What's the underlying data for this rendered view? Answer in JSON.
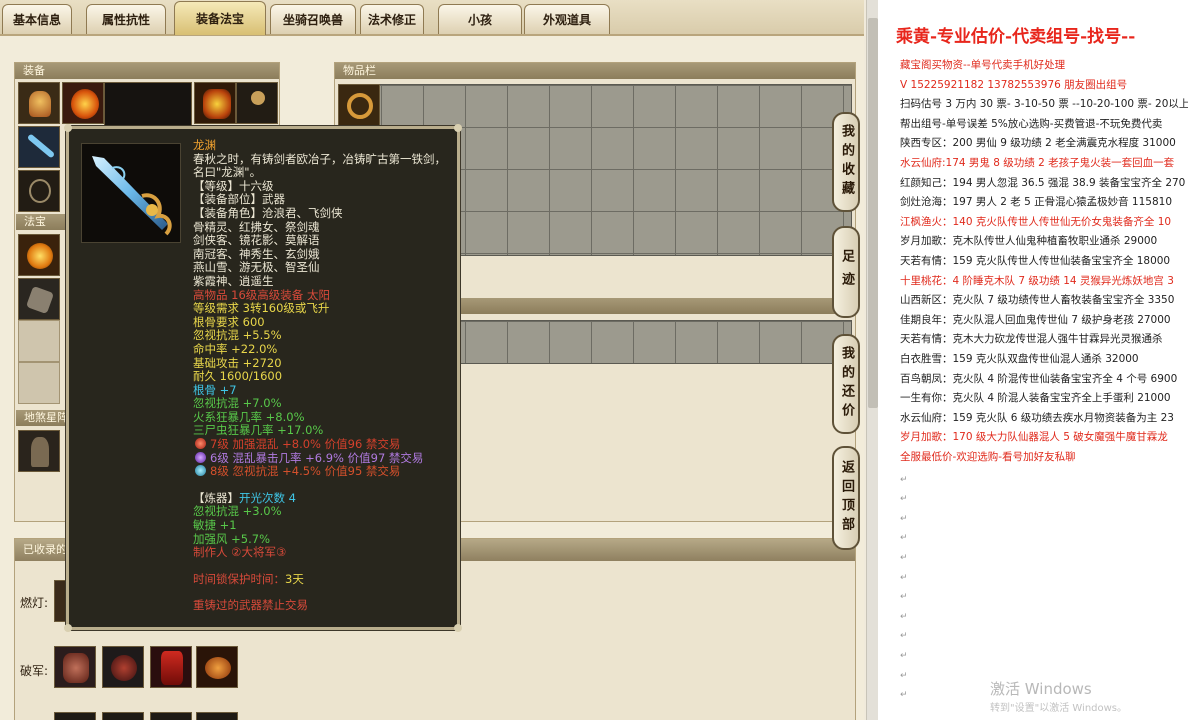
{
  "tabs": [
    "基本信息",
    "属性抗性",
    "装备法宝",
    "坐骑召唤兽",
    "法术修正",
    "小孩",
    "外观道具"
  ],
  "sections": {
    "equip": "装备",
    "inventory": "物品栏",
    "fabao": "法宝",
    "dishaxing": "地煞星阵",
    "collected": "已收录的"
  },
  "side_buttons": [
    "我的收藏",
    "足迹",
    "我的还价",
    "返回顶部"
  ],
  "collected_rows": [
    "燃灯:",
    "破军:"
  ],
  "tooltip": {
    "name": "龙渊",
    "desc1": "春秋之时，有铸剑者欧冶子，冶铸旷古第一铁剑，",
    "desc2": "名曰\"龙渊\"。",
    "level": "【等级】十六级",
    "slot": "【装备部位】武器",
    "roles_head": "【装备角色】沧浪君、飞剑侠",
    "roles": [
      "骨精灵、红拂女、祭剑魂",
      "剑侠客、镜花影、莫解语",
      "南冠客、神秀生、玄剑娥",
      "燕山雪、游无极、智圣仙",
      "紫霞神、逍遥生"
    ],
    "tradeable": "高物品 16级高级装备 太阳",
    "req1": "等级需求 3转160级或飞升",
    "req2": "根骨要求 600",
    "attrs": [
      "忽视抗混 +5.5%",
      "命中率 +22.0%",
      "基础攻击 +2720",
      "耐久 1600/1600"
    ],
    "gengu": "根骨 +7",
    "green_attrs": [
      "忽视抗混 +7.0%",
      "火系狂暴几率 +8.0%",
      "三尸虫狂暴几率 +17.0%"
    ],
    "gems": [
      {
        "text": "7级 加强混乱 +8.0% 价值96 禁交易",
        "color": "#d4402c"
      },
      {
        "text": "6级 混乱暴击几率 +6.9% 价值97 禁交易",
        "color": "#8e52d6"
      },
      {
        "text": "8级 忽视抗混 +4.5% 价值95 禁交易",
        "color": "#45a6c8"
      }
    ],
    "refine_label": "【炼器】",
    "refine_count": "开光次数 4",
    "refine_attrs": [
      "忽视抗混 +3.0%",
      "敏捷 +1",
      "加强风 +5.7%"
    ],
    "maker": "制作人 ②大将军③",
    "protect_label": "时间锁保护时间：",
    "protect_value": "3天",
    "forbid": "重铸过的武器禁止交易"
  },
  "doc": {
    "title": "乘黄-专业估价-代卖组号-找号--",
    "lines": [
      {
        "t": "藏宝阁买物资--单号代卖手机好处理",
        "red": true
      },
      {
        "t": "V 15225921182   13782553976 朋友圈出组号",
        "red": true
      },
      {
        "t": "扫码估号 3 万内 30 票- 3-10-50 票  --10-20-100 票- 20以上",
        "red": false
      },
      {
        "t": "帮出组号-单号误差 5%放心选购-买费管退-不玩免费代卖",
        "red": false
      },
      {
        "t": "陕西专区：200 男仙 9 级功绩 2 老全满震克水程度 31000",
        "red": false
      },
      {
        "t": "水云仙府:174 男鬼 8 级功绩 2 老孩子鬼火装一套回血一套",
        "red": true
      },
      {
        "t": "红颜知己：194 男人忽混 36.5 强混 38.9 装备宝宝齐全 270",
        "red": false
      },
      {
        "t": "剑灶沧海：197 男人 2 老 5 正骨混心猿孟极妙音 115810",
        "red": false
      },
      {
        "t": "江枫渔火：140 克火队传世人传世仙无价女鬼装备齐全 10",
        "red": true
      },
      {
        "t": "岁月加歌：克木队传世人仙鬼种植畜牧职业通杀 29000",
        "red": false
      },
      {
        "t": "天若有情：159 克火队传世人传世仙装备宝宝齐全 18000",
        "red": false
      },
      {
        "t": "十里桃花：4 阶睡克木队 7 级功绩 14 灵猴异光炼妖地宫 3",
        "red": true
      },
      {
        "t": "山西新区：克火队 7 级功绩传世人畜牧装备宝宝齐全 3350",
        "red": false
      },
      {
        "t": "佳期良年：克火队混人回血鬼传世仙 7 级护身老孩 27000",
        "red": false
      },
      {
        "t": "天若有情：克木大力砍龙传世混人强牛甘霖异光灵猴通杀",
        "red": false
      },
      {
        "t": "白衣胜雪：159 克火队双盘传世仙混人通杀 32000",
        "red": false
      },
      {
        "t": "百鸟朝凤：克火队 4 阶混传世仙装备宝宝齐全 4 个号 6900",
        "red": false
      },
      {
        "t": "一生有你：克火队 4 阶混人装备宝宝齐全上手蛋利 21000",
        "red": false
      },
      {
        "t": "水云仙府：159 克火队 6 级功绩去疾水月物资装备为主 23",
        "red": false
      },
      {
        "t": "岁月加歌：170 级大力队仙器混人 5 破女魔强牛魔甘霖龙",
        "red": true
      },
      {
        "t": "全服最低价-欢迎选购-看号加好友私聊",
        "red": true
      }
    ],
    "watermark1": "激活 Windows",
    "watermark2": "转到\"设置\"以激活 Windows。"
  }
}
